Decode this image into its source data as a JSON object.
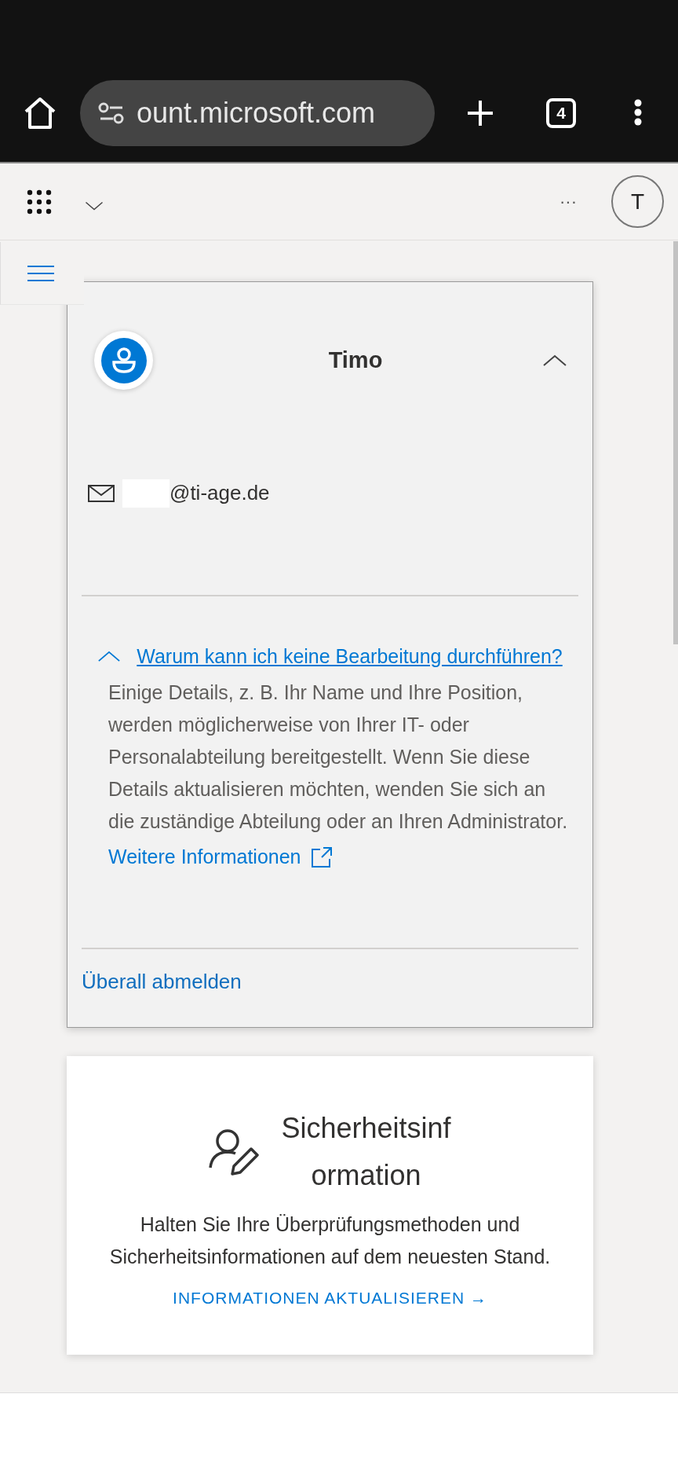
{
  "browser": {
    "url": "ount.microsoft.com",
    "tab_count": "4"
  },
  "header": {
    "avatar_initial": "T",
    "more": "···"
  },
  "profile_card": {
    "name": "Timo",
    "expanded": true,
    "email": "@ti-age.de",
    "help": {
      "expanded": true,
      "question": "Warum kann ich keine Bearbeitung durchführen?",
      "text": "Einige Details, z. B. Ihr Name und Ihre Position, werden möglicherweise von Ihrer IT- oder Personalabteilung bereitgestellt. Wenn Sie diese Details aktualisieren möchten, wenden Sie sich an die zuständige Abteilung oder an Ihren Administrator.",
      "more_link": "Weitere Informationen"
    },
    "sign_out": "Überall abmelden"
  },
  "security_card": {
    "title_lines": [
      "Sicherheitsinf",
      "ormation"
    ],
    "text": "Halten Sie Ihre Überprüfungsmethoden und Sicherheitsinformationen auf dem neuesten Stand.",
    "link": "INFORMATIONEN AKTUALISIEREN →"
  }
}
